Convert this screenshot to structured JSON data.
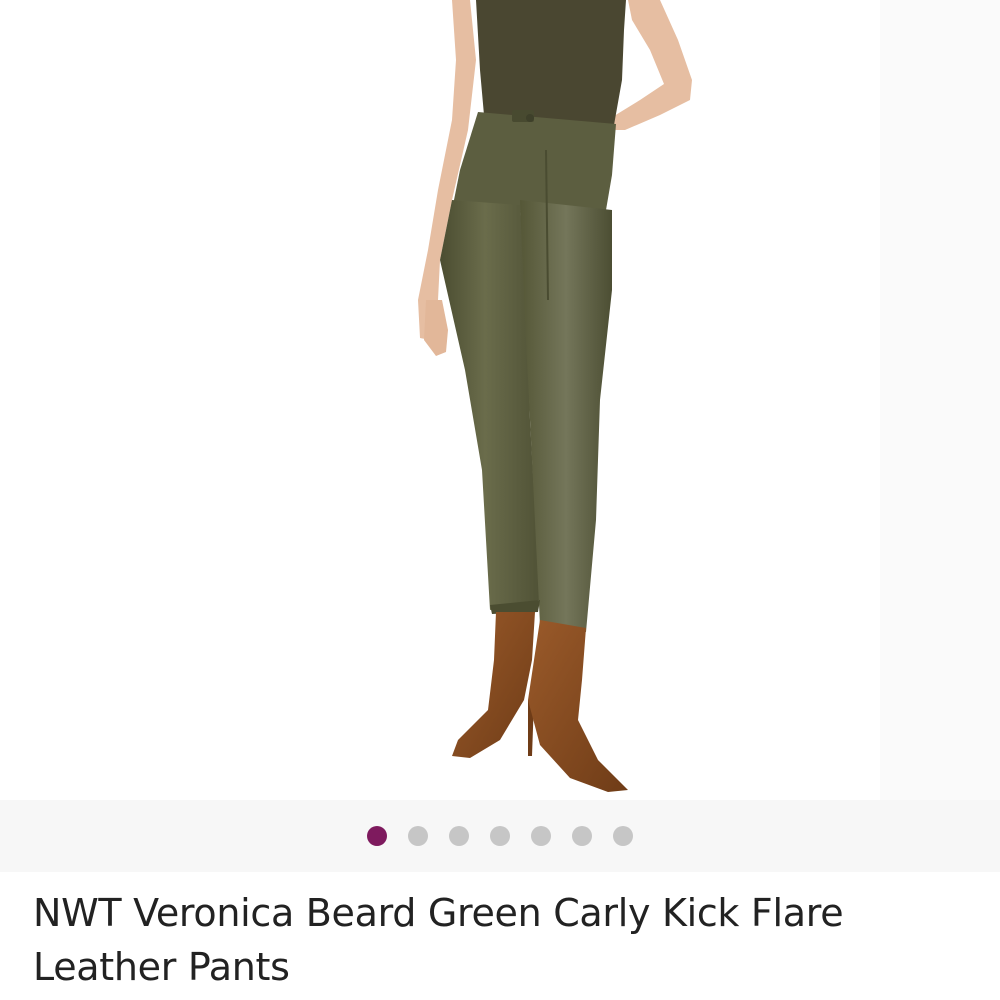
{
  "listing": {
    "title": "NWT Veronica Beard Green Carly Kick Flare Leather Pants"
  },
  "photo": {
    "subject": "olive leather pants with brown suede boots",
    "colors": {
      "pants": "#5b5d3f",
      "top": "#4a4731",
      "boots": "#8a4d22",
      "skin": "#e9c2a8"
    }
  },
  "carousel": {
    "count": 7,
    "active_index": 0,
    "active_color": "#7e1a5e",
    "inactive_color": "#c6c6c6"
  }
}
